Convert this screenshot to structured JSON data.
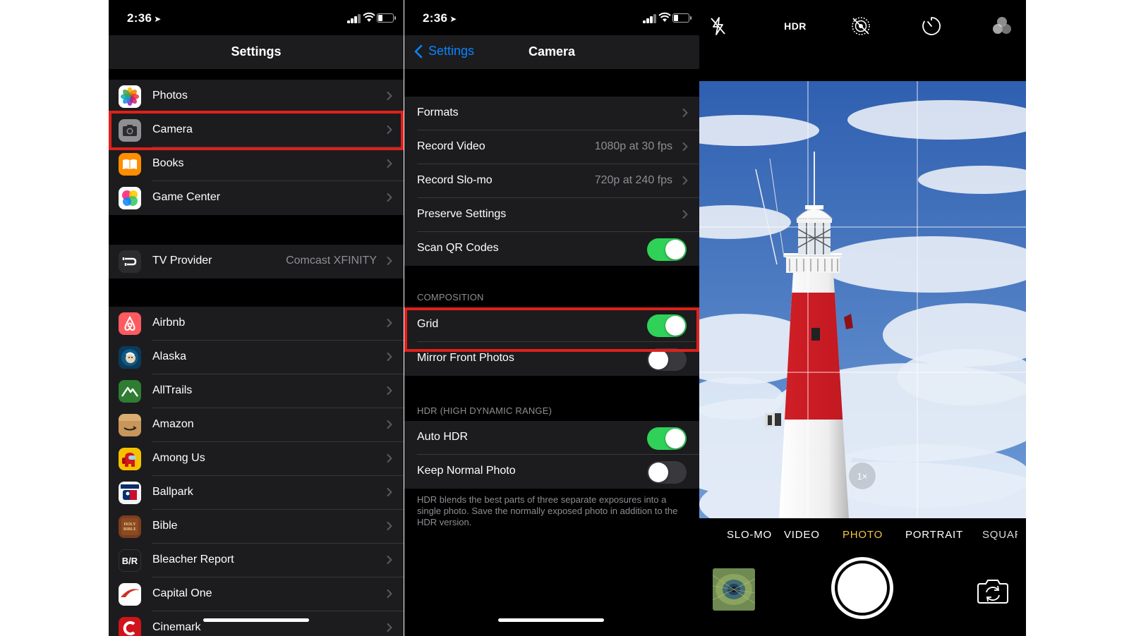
{
  "status": {
    "time": "2:36"
  },
  "settings": {
    "title": "Settings",
    "groups": [
      [
        {
          "label": "Photos",
          "icon": "photos-icon"
        },
        {
          "label": "Camera",
          "icon": "camera-icon"
        },
        {
          "label": "Books",
          "icon": "books-icon"
        },
        {
          "label": "Game Center",
          "icon": "game-center-icon"
        }
      ],
      [
        {
          "label": "TV Provider",
          "value": "Comcast XFINITY",
          "icon": "tv-provider-icon"
        }
      ],
      [
        {
          "label": "Airbnb",
          "icon": "airbnb-icon"
        },
        {
          "label": "Alaska",
          "icon": "alaska-icon"
        },
        {
          "label": "AllTrails",
          "icon": "alltrails-icon"
        },
        {
          "label": "Amazon",
          "icon": "amazon-icon"
        },
        {
          "label": "Among Us",
          "icon": "among-us-icon"
        },
        {
          "label": "Ballpark",
          "icon": "ballpark-icon"
        },
        {
          "label": "Bible",
          "icon": "bible-icon"
        },
        {
          "label": "Bleacher Report",
          "icon": "bleacher-report-icon",
          "icon_text": "B/R"
        },
        {
          "label": "Capital One",
          "icon": "capital-one-icon"
        },
        {
          "label": "Cinemark",
          "icon": "cinemark-icon"
        }
      ]
    ]
  },
  "camera_settings": {
    "back_label": "Settings",
    "title": "Camera",
    "rows": [
      {
        "label": "Formats"
      },
      {
        "label": "Record Video",
        "value": "1080p at 30 fps"
      },
      {
        "label": "Record Slo-mo",
        "value": "720p at 240 fps"
      },
      {
        "label": "Preserve Settings"
      },
      {
        "label": "Scan QR Codes",
        "toggle": true
      }
    ],
    "composition_header": "COMPOSITION",
    "composition_rows": [
      {
        "label": "Grid",
        "toggle": true
      },
      {
        "label": "Mirror Front Photos",
        "toggle": false
      }
    ],
    "hdr_header": "HDR (HIGH DYNAMIC RANGE)",
    "hdr_rows": [
      {
        "label": "Auto HDR",
        "toggle": true
      },
      {
        "label": "Keep Normal Photo",
        "toggle": false
      }
    ],
    "hdr_footnote": "HDR blends the best parts of three separate exposures into a single photo. Save the normally exposed photo in addition to the HDR version."
  },
  "camera_app": {
    "hdr_label": "HDR",
    "zoom_label": "1×",
    "modes": [
      "SLO-MO",
      "VIDEO",
      "PHOTO",
      "PORTRAIT",
      "SQUARE"
    ],
    "active_mode": "PHOTO"
  },
  "colors": {
    "accent": "#0a84ff",
    "toggle_on": "#30d158",
    "highlight": "#e0201b",
    "active_mode": "#f5c542"
  }
}
